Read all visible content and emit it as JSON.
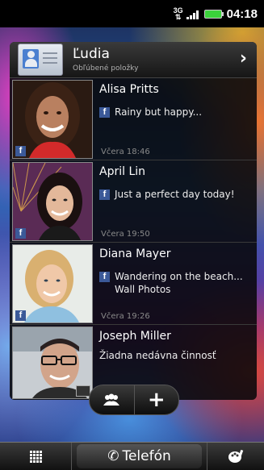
{
  "status_bar": {
    "network": "3G",
    "time": "04:18"
  },
  "widget": {
    "title": "Ľudia",
    "subtitle": "Obľúbené položky",
    "contacts": [
      {
        "name": "Alisa Pritts",
        "status": "Rainy but happy...",
        "time": "Včera 18:46",
        "source": "facebook"
      },
      {
        "name": "April Lin",
        "status": "Just a perfect day today!",
        "time": "Včera 19:50",
        "source": "facebook"
      },
      {
        "name": "Diana Mayer",
        "status": "Wandering on the beach... Wall Photos",
        "time": "Včera 19:26",
        "source": "facebook"
      },
      {
        "name": "Joseph Miller",
        "status": "Žiadna nedávna činnosť",
        "time": "",
        "source": "chat"
      }
    ]
  },
  "dock": {
    "phone_label": "Telefón"
  },
  "icons": {
    "header": "contact-card-icon",
    "group": "group-icon",
    "add": "plus-icon",
    "apps": "app-grid-icon",
    "phone": "phone-icon",
    "personalize": "personalize-icon"
  },
  "colors": {
    "facebook": "#3b5998",
    "battery": "#3bd33b"
  }
}
